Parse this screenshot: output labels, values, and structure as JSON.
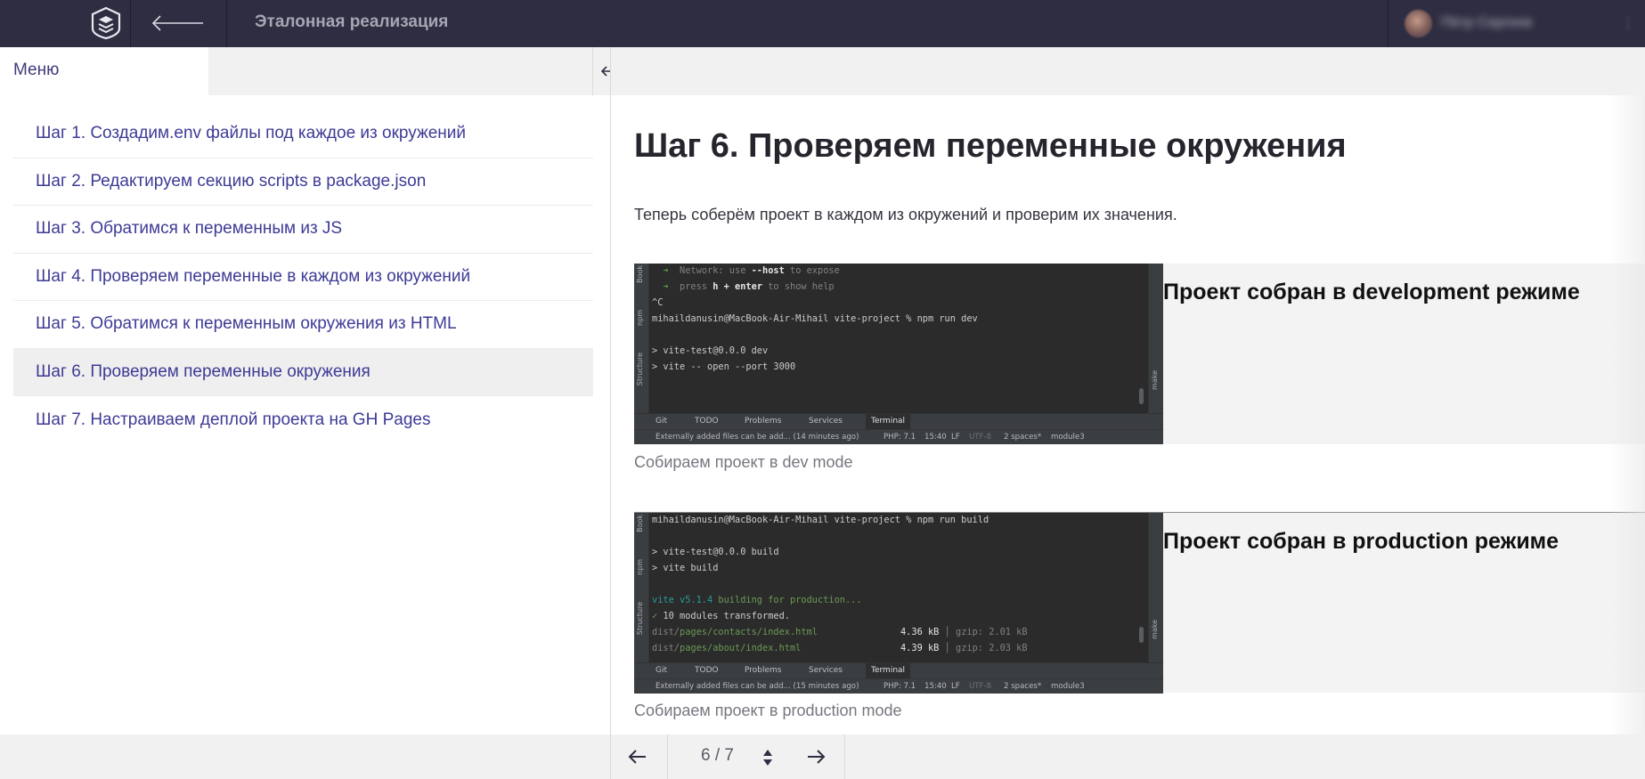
{
  "header": {
    "app_title": "Эталонная реализация",
    "user_name": "Пётр Сергеев",
    "user_menu_glyph": "⋮"
  },
  "sidebar": {
    "menu_tab_label": "Меню",
    "resize_glyph": "double-arrow-horizontal-icon",
    "items": [
      {
        "label": "Шаг 1. Создадим.env файлы под каждое из окружений",
        "active": false
      },
      {
        "label": "Шаг 2. Редактируем секцию scripts в package.json",
        "active": false
      },
      {
        "label": "Шаг 3. Обратимся к переменным из JS",
        "active": false
      },
      {
        "label": "Шаг 4. Проверяем переменные в каждом из окружений",
        "active": false
      },
      {
        "label": "Шаг 5. Обратимся к переменным окружения из HTML",
        "active": false
      },
      {
        "label": "Шаг 6. Проверяем переменные окружения",
        "active": true
      },
      {
        "label": "Шаг 7. Настраиваем деплой проекта на GH Pages",
        "active": false
      }
    ]
  },
  "content": {
    "title": "Шаг 6. Проверяем переменные окружения",
    "intro": "Теперь соберём проект в каждом из окружений и проверим их значения.",
    "screenshot1": {
      "caption_inside": "Проект собран в development режиме",
      "caption_below": "Собираем проект в dev mode",
      "terminal_lines": [
        "➜  Network: use --host to expose",
        "➜  press h + enter to show help",
        "^C",
        "mihaildanusin@MacBook-Air-Mihail vite-project % npm run dev",
        "",
        "> vite-test@0.0.0 dev",
        "> vite -- open --port 3000"
      ],
      "status_text": "Externally added files can be add... (14 minutes ago)"
    },
    "screenshot2": {
      "caption_inside": "Проект собран в production режиме",
      "caption_below": "Собираем проект в production mode",
      "terminal_lines": [
        "mihaildanusin@MacBook-Air-Mihail vite-project % npm run build",
        "",
        "> vite-test@0.0.0 build",
        "> vite build",
        "",
        "vite v5.1.4 building for production...",
        "✓ 10 modules transformed.",
        "dist/pages/contacts/index.html               4.36 kB │ gzip: 2.01 kB",
        "dist/pages/about/index.html                  4.39 kB │ gzip: 2.03 kB"
      ],
      "status_text": "Externally added files can be add... (15 minutes ago)"
    },
    "ide": {
      "left_strip": [
        "Book",
        "npm",
        "Structure"
      ],
      "right_strip": [
        "make"
      ],
      "tabs": [
        "Git",
        "TODO",
        "Problems",
        "Services",
        "Terminal"
      ],
      "status": {
        "php": "PHP: 7.1",
        "cursor": "15:40",
        "eol": "LF",
        "encoding": "UTF-8",
        "indent": "2 spaces*",
        "branch": "module3"
      }
    }
  },
  "pagination": {
    "label": "6 / 7",
    "prev_icon": "arrow-left-icon",
    "next_icon": "arrow-right-icon"
  },
  "colors": {
    "topbar": "#2e2d41",
    "link": "#3d3b95",
    "active_item_bg": "#efefef",
    "terminal_bg": "#2b2b2b"
  }
}
